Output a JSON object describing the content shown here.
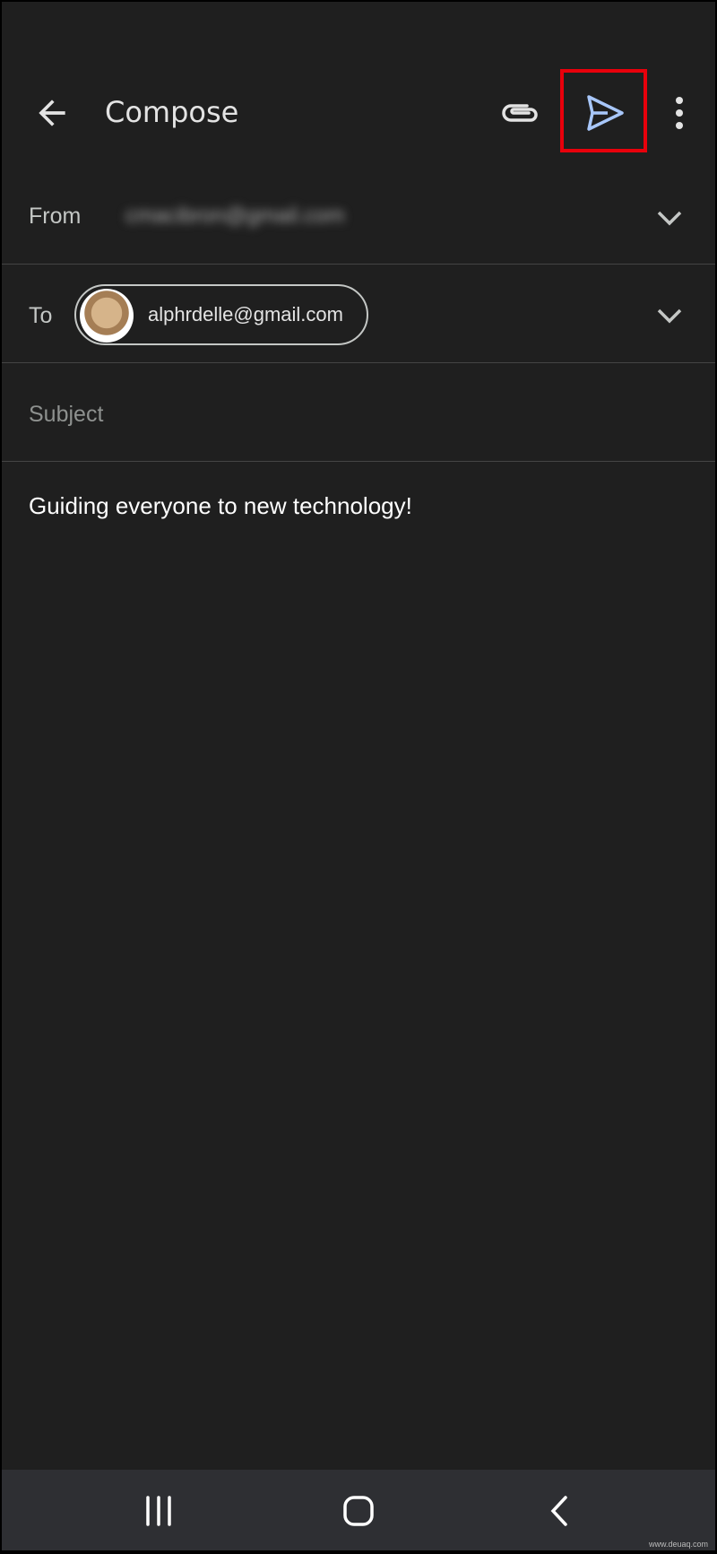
{
  "header": {
    "title": "Compose",
    "icons": [
      "back-arrow-icon",
      "paperclip-icon",
      "send-icon",
      "more-vert-icon"
    ],
    "highlight_color": "#e8000b",
    "send_color": "#a8c7fa"
  },
  "from": {
    "label": "From",
    "value": "cmacibron@gmail.com"
  },
  "to": {
    "label": "To",
    "recipient": "alphrdelle@gmail.com"
  },
  "subject": {
    "placeholder": "Subject"
  },
  "body": {
    "text": "Guiding everyone to new technology!"
  },
  "navbar": {
    "icons": [
      "recent-apps-icon",
      "home-icon",
      "back-icon"
    ]
  },
  "watermark": "www.deuaq.com"
}
